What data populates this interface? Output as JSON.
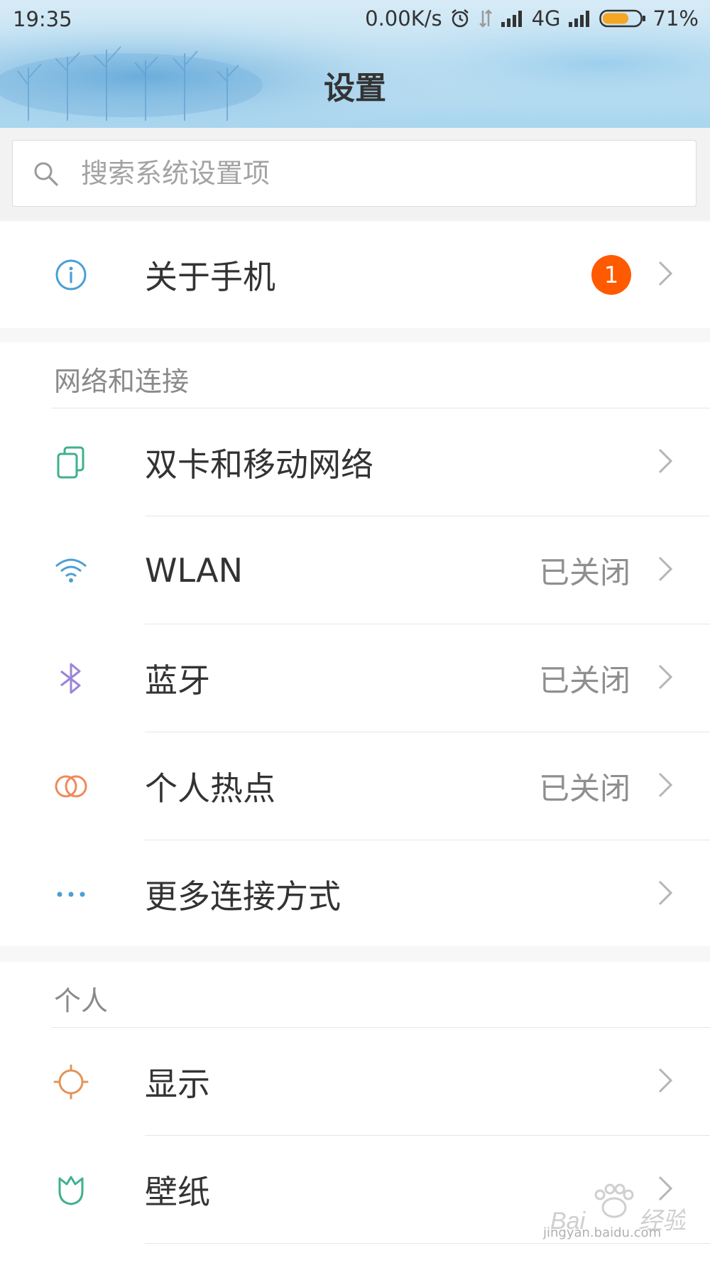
{
  "status_bar": {
    "time": "19:35",
    "net_speed": "0.00K/s",
    "network_type": "4G",
    "battery": "71%",
    "battery_level": 0.71
  },
  "header": {
    "title": "设置"
  },
  "search": {
    "placeholder": "搜索系统设置项"
  },
  "about": {
    "label": "关于手机",
    "badge": "1"
  },
  "sections": {
    "network": {
      "title": "网络和连接",
      "items": [
        {
          "label": "双卡和移动网络",
          "value": "",
          "icon": "sim-card-icon"
        },
        {
          "label": "WLAN",
          "value": "已关闭",
          "icon": "wifi-icon"
        },
        {
          "label": "蓝牙",
          "value": "已关闭",
          "icon": "bluetooth-icon"
        },
        {
          "label": "个人热点",
          "value": "已关闭",
          "icon": "hotspot-icon"
        },
        {
          "label": "更多连接方式",
          "value": "",
          "icon": "more-dots-icon"
        }
      ]
    },
    "personal": {
      "title": "个人",
      "items": [
        {
          "label": "显示",
          "icon": "brightness-icon"
        },
        {
          "label": "壁纸",
          "icon": "wallpaper-icon"
        }
      ]
    }
  },
  "colors": {
    "badge": "#ff5a00",
    "accent_blue": "#4a9fd5"
  },
  "watermark": "jingyan.baidu.com"
}
